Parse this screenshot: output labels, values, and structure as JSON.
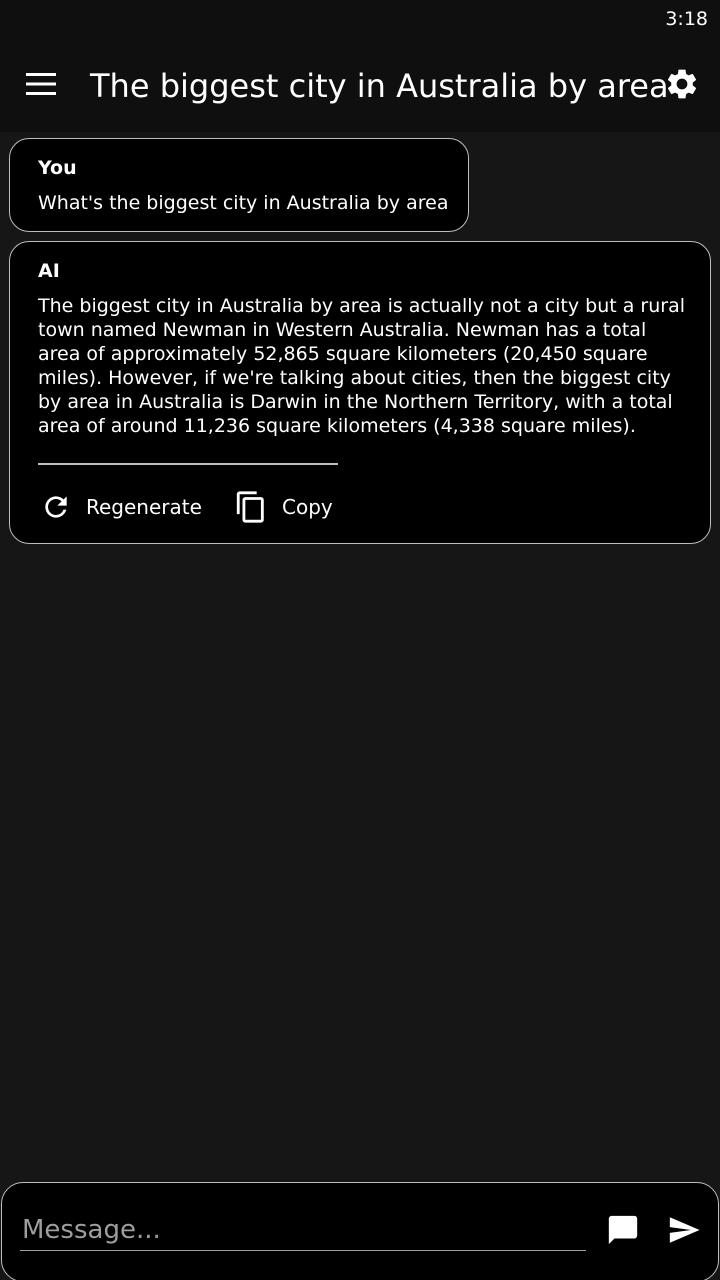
{
  "status_bar": {
    "time": "3:18"
  },
  "app_bar": {
    "title": "The biggest city in Australia by area",
    "menu_icon": "hamburger-menu-icon",
    "settings_icon": "gear-icon"
  },
  "conversation": [
    {
      "sender": "You",
      "text": "What's the biggest city in Australia by area"
    },
    {
      "sender": "AI",
      "text": "The biggest city in Australia by area is actually not a city but a rural town named Newman in Western Australia. Newman has a total area of approximately 52,865 square kilometers (20,450 square miles). However, if we're talking about cities, then the biggest city by area in Australia is Darwin in the Northern Territory, with a total area of around 11,236 square kilometers (4,338 square miles).",
      "actions": {
        "regenerate_label": "Regenerate",
        "copy_label": "Copy"
      }
    }
  ],
  "composer": {
    "placeholder": "Message...",
    "value": ""
  },
  "colors": {
    "background": "#161616",
    "bar": "#0f0f0f",
    "bubble": "#000000",
    "border": "#bdbdbd",
    "text": "#ffffff",
    "placeholder": "#9e9e9e"
  }
}
